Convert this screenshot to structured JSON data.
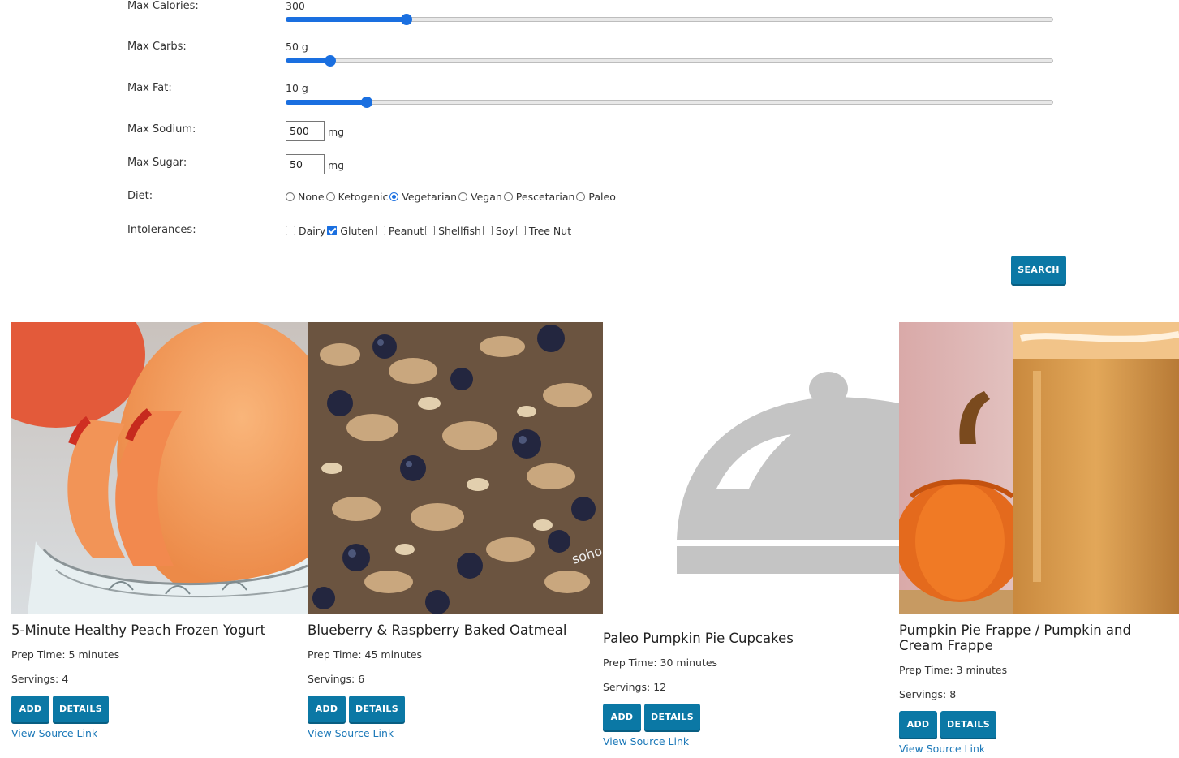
{
  "filters": {
    "calories": {
      "label": "Max Calories:",
      "value_text": "300",
      "fraction": 0.157
    },
    "carbs": {
      "label": "Max Carbs:",
      "value_text": "50 g",
      "fraction": 0.058
    },
    "fat": {
      "label": "Max Fat:",
      "value_text": "10 g",
      "fraction": 0.106
    },
    "sodium": {
      "label": "Max Sodium:",
      "value": "500",
      "unit": "mg"
    },
    "sugar": {
      "label": "Max Sugar:",
      "value": "50",
      "unit": "mg"
    },
    "diet": {
      "label": "Diet:",
      "options": [
        "None",
        "Ketogenic",
        "Vegetarian",
        "Vegan",
        "Pescetarian",
        "Paleo"
      ],
      "selected": "Vegetarian"
    },
    "intolerances": {
      "label": "Intolerances:",
      "options": [
        "Dairy",
        "Gluten",
        "Peanut",
        "Shellfish",
        "Soy",
        "Tree Nut"
      ],
      "checked": [
        "Gluten"
      ]
    },
    "search_label": "SEARCH"
  },
  "accent_color": "#1a6fe0",
  "button_color": "#0b78a5",
  "recipes": [
    {
      "title": "5-Minute Healthy Peach Frozen Yogurt",
      "prep": "Prep Time: 5 minutes",
      "servings": "Servings: 4",
      "add": "ADD",
      "details": "DETAILS",
      "link": "View Source Link",
      "image": "peach-frozen-yogurt-photo"
    },
    {
      "title": "Blueberry & Raspberry Baked Oatmeal",
      "prep": "Prep Time: 45 minutes",
      "servings": "Servings: 6",
      "add": "ADD",
      "details": "DETAILS",
      "link": "View Source Link",
      "image": "baked-oatmeal-photo",
      "watermark": "soho"
    },
    {
      "title": "Paleo Pumpkin Pie Cupcakes",
      "prep": "Prep Time: 30 minutes",
      "servings": "Servings: 12",
      "add": "ADD",
      "details": "DETAILS",
      "link": "View Source Link",
      "image": "cloche-placeholder-icon"
    },
    {
      "title": "Pumpkin Pie Frappe / Pumpkin and Cream Frappe",
      "prep": "Prep Time: 3 minutes",
      "servings": "Servings: 8",
      "add": "ADD",
      "details": "DETAILS",
      "link": "View Source Link",
      "image": "pumpkin-frappe-photo"
    }
  ]
}
